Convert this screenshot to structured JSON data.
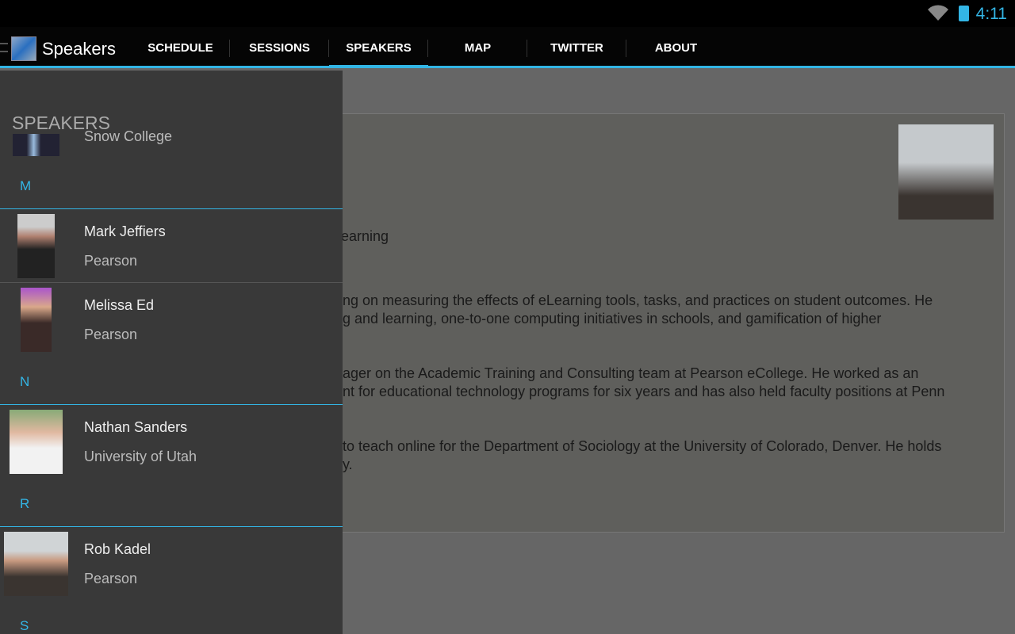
{
  "status_bar": {
    "time": "4:11"
  },
  "action_bar": {
    "title": "Speakers",
    "tabs": [
      {
        "label": "SCHEDULE"
      },
      {
        "label": "SESSIONS"
      },
      {
        "label": "SPEAKERS",
        "active": true
      },
      {
        "label": "MAP"
      },
      {
        "label": "TWITTER"
      },
      {
        "label": "ABOUT"
      }
    ]
  },
  "accent_color": "#33b5e5",
  "detail": {
    "bio_lines": [
      "earning",
      "ng on measuring the effects of eLearning tools, tasks, and practices on student outcomes. He",
      "g and learning, one-to-one computing initiatives in schools, and gamification of higher",
      "ager on the Academic Training and Consulting team at Pearson eCollege. He worked as an",
      "nt for educational technology programs for six years and has also held faculty positions at Penn",
      "to teach online for the Department of Sociology at the University of Colorado, Denver. He holds",
      "y."
    ]
  },
  "drawer": {
    "header": "SPEAKERS",
    "partial_org": "Snow College",
    "sections": [
      {
        "letter": "M",
        "speakers": [
          {
            "name": "Mark Jeffiers",
            "org": "Pearson"
          },
          {
            "name": "Melissa Ed",
            "org": "Pearson"
          }
        ]
      },
      {
        "letter": "N",
        "speakers": [
          {
            "name": "Nathan Sanders",
            "org": "University of Utah"
          }
        ]
      },
      {
        "letter": "R",
        "speakers": [
          {
            "name": "Rob Kadel",
            "org": "Pearson"
          }
        ]
      },
      {
        "letter": "S",
        "speakers": []
      }
    ]
  }
}
